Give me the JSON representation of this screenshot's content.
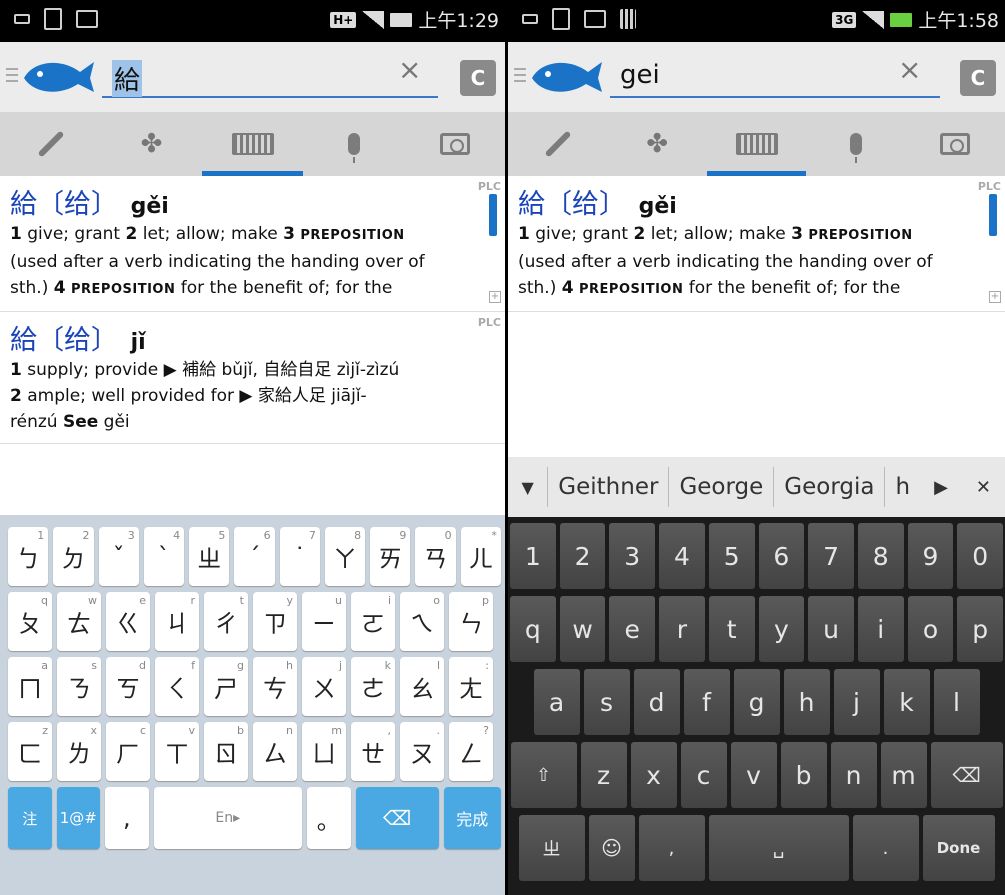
{
  "left": {
    "status": {
      "network": "H+",
      "time": "上午1:29"
    },
    "search": {
      "query": "給"
    },
    "clear_glyph": "×",
    "c_label": "C",
    "modes": [
      "brush",
      "puzzle",
      "keyboard",
      "mic",
      "camera"
    ],
    "active_mode": 2,
    "entries": [
      {
        "trad": "給",
        "simp": "〔给〕",
        "pinyin": "gěi",
        "lines": [
          {
            "html": "<b>1</b> give; grant <b>2</b> let; allow; make <b>3</b> <span class='sc'>PREPOSITION</span>"
          },
          {
            "html": "(used after a verb indicating the handing over of"
          },
          {
            "html": "sth.) <b>4</b> <span class='sc'>PREPOSITION</span> for the benefit of; for the"
          }
        ],
        "tag": "PLC"
      },
      {
        "trad": "給",
        "simp": "〔给〕",
        "pinyin": "jǐ",
        "lines": [
          {
            "html": "<b>1</b> supply; provide ▶ 補給 bǔjǐ, 自給自足 zìjǐ-zìzú"
          },
          {
            "html": "<b>2</b> ample; well provided for ▶ 家給人足 jiājǐ-"
          },
          {
            "html": "rénzú <b>See</b> gěi"
          }
        ],
        "tag": "PLC"
      }
    ],
    "keyboard": {
      "rows": [
        [
          [
            "ㄅ",
            "1"
          ],
          [
            "ㄉ",
            "2"
          ],
          [
            "ˇ",
            "3"
          ],
          [
            "ˋ",
            "4"
          ],
          [
            "ㄓ",
            "5"
          ],
          [
            "ˊ",
            "6"
          ],
          [
            "˙",
            "7"
          ],
          [
            "ㄚ",
            "8"
          ],
          [
            "ㄞ",
            "9"
          ],
          [
            "ㄢ",
            "0"
          ],
          [
            "ㄦ",
            "*"
          ]
        ],
        [
          [
            "ㄆ",
            "q"
          ],
          [
            "ㄊ",
            "w"
          ],
          [
            "ㄍ",
            "e"
          ],
          [
            "ㄐ",
            "r"
          ],
          [
            "ㄔ",
            "t"
          ],
          [
            "ㄗ",
            "y"
          ],
          [
            "ㄧ",
            "u"
          ],
          [
            "ㄛ",
            "i"
          ],
          [
            "ㄟ",
            "o"
          ],
          [
            "ㄣ",
            "p"
          ]
        ],
        [
          [
            "ㄇ",
            "a"
          ],
          [
            "ㄋ",
            "s"
          ],
          [
            "ㄎ",
            "d"
          ],
          [
            "ㄑ",
            "f"
          ],
          [
            "ㄕ",
            "g"
          ],
          [
            "ㄘ",
            "h"
          ],
          [
            "ㄨ",
            "j"
          ],
          [
            "ㄜ",
            "k"
          ],
          [
            "ㄠ",
            "l"
          ],
          [
            "ㄤ",
            ":"
          ]
        ],
        [
          [
            "ㄈ",
            "z"
          ],
          [
            "ㄌ",
            "x"
          ],
          [
            "ㄏ",
            "c"
          ],
          [
            "ㄒ",
            "v"
          ],
          [
            "ㄖ",
            "b"
          ],
          [
            "ㄙ",
            "n"
          ],
          [
            "ㄩ",
            "m"
          ],
          [
            "ㄝ",
            ","
          ],
          [
            "ㄡ",
            "."
          ],
          [
            "ㄥ",
            "?"
          ]
        ]
      ],
      "bottom": {
        "zhu": "注",
        "sym": "1@#",
        "comma": ",",
        "space": "En▸",
        "period": "。",
        "done": "完成"
      }
    }
  },
  "right": {
    "status": {
      "network": "3G",
      "time": "上午1:58"
    },
    "search": {
      "query": "gei"
    },
    "clear_glyph": "×",
    "c_label": "C",
    "active_mode": 2,
    "entries": [
      {
        "trad": "給",
        "simp": "〔给〕",
        "pinyin": "gěi",
        "lines": [
          {
            "html": "<b>1</b> give; grant <b>2</b> let; allow; make <b>3</b> <span class='sc'>PREPOSITION</span>"
          },
          {
            "html": "(used after a verb indicating the handing over of"
          },
          {
            "html": "sth.) <b>4</b> <span class='sc'>PREPOSITION</span> for the benefit of; for the"
          }
        ],
        "tag": "PLC"
      }
    ],
    "suggestions": [
      "Geithner",
      "George",
      "Georgia",
      "h"
    ],
    "keyboard": {
      "rows": [
        [
          "1",
          "2",
          "3",
          "4",
          "5",
          "6",
          "7",
          "8",
          "9",
          "0"
        ],
        [
          "q",
          "w",
          "e",
          "r",
          "t",
          "y",
          "u",
          "i",
          "o",
          "p"
        ],
        [
          "a",
          "s",
          "d",
          "f",
          "g",
          "h",
          "j",
          "k",
          "l"
        ],
        [
          "z",
          "x",
          "c",
          "v",
          "b",
          "n",
          "m"
        ]
      ],
      "bottom": {
        "zhu": "ㄓ",
        "comma": ",",
        "period": ".",
        "done": "Done"
      }
    }
  },
  "colors": {
    "accent": "#1b73c8",
    "headword": "#1b44b8",
    "zhuyin_key_blue": "#4aa8e2"
  }
}
